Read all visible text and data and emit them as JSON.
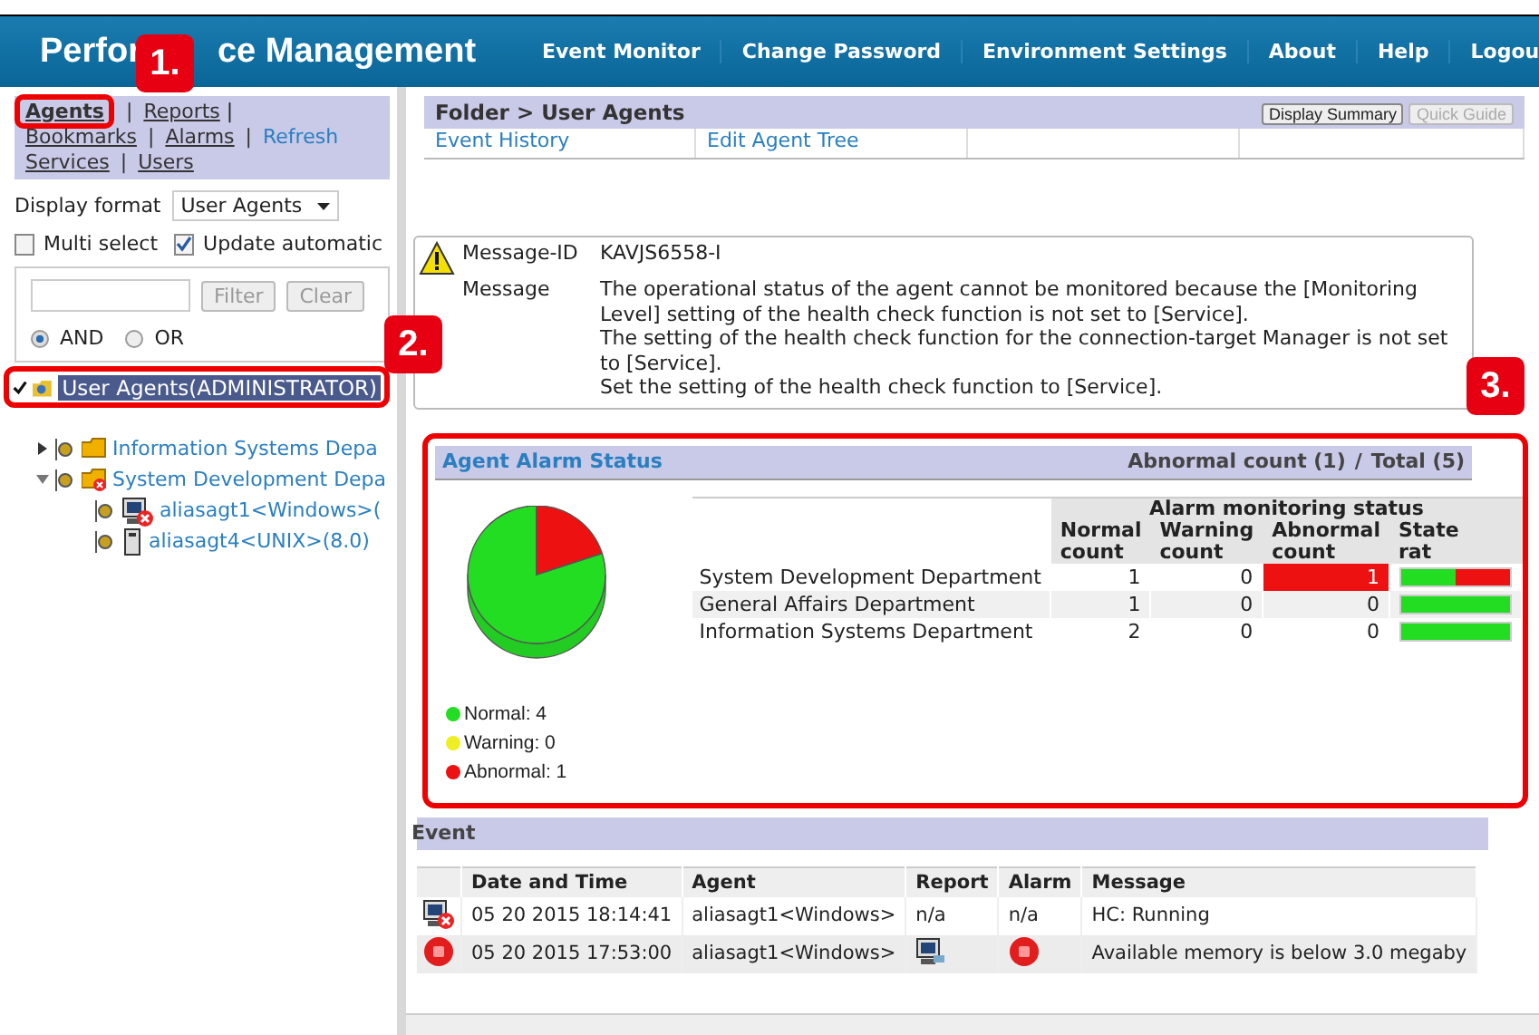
{
  "header": {
    "title_parts": [
      "Perfor",
      "ce Management"
    ],
    "nav": [
      "Event Monitor",
      "Change Password",
      "Environment Settings",
      "About",
      "Help",
      "Logou"
    ]
  },
  "sidebar": {
    "separator": "|",
    "nav_links": [
      {
        "label": "Agents",
        "selected": true
      },
      {
        "label": "Reports",
        "selected": false
      },
      {
        "label": "Bookmarks",
        "selected": false
      },
      {
        "label": "Alarms",
        "selected": false
      },
      {
        "label": "Refresh",
        "selected": false
      },
      {
        "label": "Services",
        "selected": false
      },
      {
        "label": "Users",
        "selected": false
      }
    ],
    "display_format": {
      "label": "Display format",
      "value": "User Agents"
    },
    "options": [
      {
        "label": "Multi select",
        "checked": false
      },
      {
        "label": "Update automatic",
        "checked": true
      }
    ],
    "filter": {
      "button": "Filter",
      "clear": "Clear",
      "modes": [
        {
          "label": "AND",
          "selected": true
        },
        {
          "label": "OR",
          "selected": false
        }
      ]
    },
    "tree": [
      {
        "label": "User Agents(ADMINISTRATOR)",
        "kind": "root",
        "checked": true,
        "selected": true,
        "children": [
          {
            "label": "Information Systems Depa",
            "kind": "folder",
            "expanded": false,
            "alert": false
          },
          {
            "label": "System Development Depa",
            "kind": "folder",
            "expanded": true,
            "alert": true,
            "children": [
              {
                "label": "aliasagt1<Windows>(",
                "kind": "windows",
                "alert": true
              },
              {
                "label": "aliasagt4<UNIX>(8.0)",
                "kind": "unix",
                "alert": false
              }
            ]
          }
        ]
      }
    ]
  },
  "main": {
    "breadcrumb": "Folder > User Agents",
    "buttons": [
      {
        "label": "Display Summary",
        "disabled": false
      },
      {
        "label": "Quick Guide",
        "disabled": true
      }
    ],
    "links": [
      "Event History",
      "Edit Agent Tree"
    ],
    "message": {
      "id_label": "Message-ID",
      "id": "KAVJS6558-I",
      "label": "Message",
      "lines": [
        "The operational status of the agent cannot be monitored because the [Monitoring Level] setting of the health check function is not set to [Service].",
        "The setting of the health check function for the connection-target Manager is not set to [Service].",
        "Set the setting of the health check function to [Service]."
      ]
    },
    "alarm_status": {
      "title": "Agent Alarm Status",
      "abnormal_count": "Abnormal count (1)",
      "separator": "/",
      "total": "Total (5)",
      "chart_data": {
        "type": "pie",
        "categories": [
          "Normal: 4",
          "Warning: 0",
          "Abnormal: 1"
        ],
        "values": [
          80,
          0,
          20
        ],
        "colors": [
          "#22dd22",
          "#eeee22",
          "#ee1111"
        ]
      },
      "group_header": "Alarm monitoring status",
      "columns": [
        "Normal count",
        "Warning count",
        "Abnormal count",
        "State rat"
      ],
      "rows": [
        {
          "name": "System Development Department",
          "normal": "1",
          "warning": "0",
          "abnormal": "1",
          "abnormal_alert": true,
          "level": 0.5
        },
        {
          "name": "General Affairs Department",
          "normal": "1",
          "warning": "0",
          "abnormal": "0",
          "abnormal_alert": false,
          "level": 1
        },
        {
          "name": "Information Systems Department",
          "normal": "2",
          "warning": "0",
          "abnormal": "0",
          "abnormal_alert": false,
          "level": 1
        }
      ]
    },
    "events": {
      "title": "Event",
      "columns": [
        "Date and Time",
        "Agent",
        "Report",
        "Alarm",
        "Message"
      ],
      "rows": [
        {
          "kind": "agent-error",
          "date": "05 20 2015 18:14:41",
          "agent": "aliasagt1<Windows>",
          "report": {
            "kind": "text",
            "text": "n/a"
          },
          "alarm": {
            "kind": "text",
            "text": "n/a"
          },
          "message": "HC: Running"
        },
        {
          "kind": "alarm",
          "date": "05 20 2015 17:53:00",
          "agent": "aliasagt1<Windows>",
          "report": {
            "kind": "icon"
          },
          "alarm": {
            "kind": "icon"
          },
          "message": "Available memory is below 3.0 megaby"
        }
      ]
    }
  },
  "callouts": [
    "1.",
    "2.",
    "3."
  ]
}
